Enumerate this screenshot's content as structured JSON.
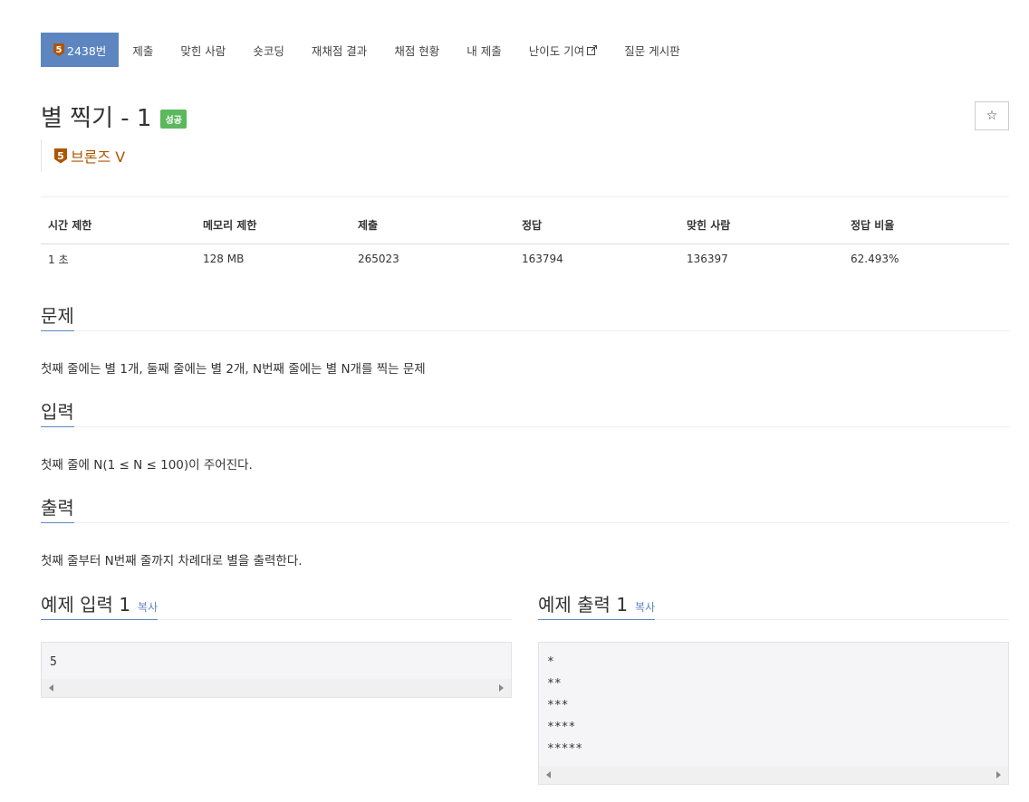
{
  "tabs": {
    "problem_tier_number": "5",
    "problem_number": "2438번",
    "submit": "제출",
    "solvers": "맞힌 사람",
    "shortest": "숏코딩",
    "rejudge": "재채점 결과",
    "judge_status": "채점 현황",
    "my_submissions": "내 제출",
    "difficulty": "난이도 기여",
    "board": "질문 게시판"
  },
  "problem": {
    "title": "별 찍기 - 1",
    "status_badge": "성공",
    "star_icon": "☆",
    "tier_number": "5",
    "tier_name": "브론즈 V",
    "tier_color": "#ad5600"
  },
  "info": {
    "headers": [
      "시간 제한",
      "메모리 제한",
      "제출",
      "정답",
      "맞힌 사람",
      "정답 비율"
    ],
    "values": [
      "1 초",
      "128 MB",
      "265023",
      "163794",
      "136397",
      "62.493%"
    ]
  },
  "sections": {
    "problem_title": "문제",
    "problem_text": "첫째 줄에는 별 1개, 둘째 줄에는 별 2개, N번째 줄에는 별 N개를 찍는 문제",
    "input_title": "입력",
    "input_text": "첫째 줄에 N(1 ≤ N ≤ 100)이 주어진다.",
    "output_title": "출력",
    "output_text": "첫째 줄부터 N번째 줄까지 차례대로 별을 출력한다."
  },
  "samples": {
    "input_title": "예제 입력 1",
    "output_title": "예제 출력 1",
    "copy_label": "복사",
    "input_text": "5",
    "output_text": "*\n**\n***\n****\n*****"
  },
  "colors": {
    "accent": "#5d86c1",
    "success": "#5cb85c"
  }
}
